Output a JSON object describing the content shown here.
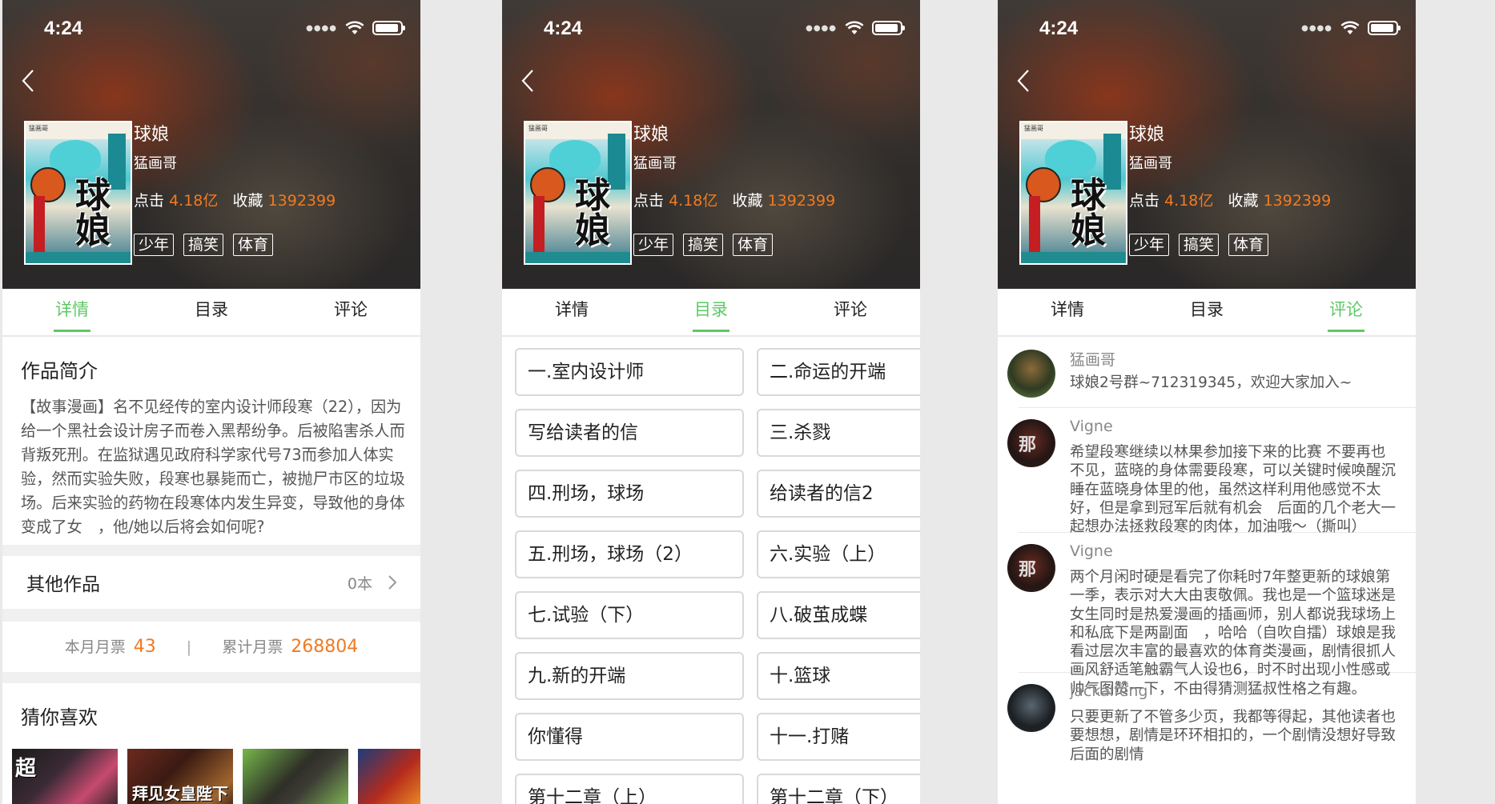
{
  "status": {
    "time": "4:24"
  },
  "comic": {
    "title": "球娘",
    "author": "猛画哥",
    "clicks_label": "点击",
    "clicks": "4.18亿",
    "favorites_label": "收藏",
    "favorites": "1392399",
    "tags": [
      "少年",
      "搞笑",
      "体育"
    ],
    "cover_head": "猛画哥",
    "cover_title": "球娘"
  },
  "tabs": [
    "详情",
    "目录",
    "评论"
  ],
  "detail": {
    "intro_heading": "作品简介",
    "intro_text": "【故事漫画】名不见经传的室内设计师段寒（22），因为给一个黑社会设计房子而卷入黑帮纷争。后被陷害杀人而背叛死刑。在监狱遇见政府科学家代号73而参加人体实验，然而实验失败，段寒也暴毙而亡，被抛尸市区的垃圾场。后来实验的药物在段寒体内发生异变，导致他的身体变成了女　，他/她以后将会如何呢?",
    "other_works_label": "其他作品",
    "other_works_count": "0本",
    "month_ticket_label": "本月月票",
    "month_ticket": "43",
    "separator": "|",
    "total_ticket_label": "累计月票",
    "total_ticket": "268804",
    "guess_heading": "猜你喜欢",
    "rec_texts": [
      "超",
      "拜见女皇陛下"
    ]
  },
  "catalog": [
    "一.室内设计师",
    "二.命运的开端",
    "写给读者的信",
    "三.杀戮",
    "四.刑场，球场",
    "给读者的信2",
    "五.刑场，球场（2）",
    "六.实验（上）",
    "七.试验（下）",
    "八.破茧成蝶",
    "九.新的开端",
    "十.篮球",
    "你懂得",
    "十一.打赌",
    "第十二章（上）",
    "第十二章（下）"
  ],
  "comments": [
    {
      "user": "猛画哥",
      "text": "球娘2号群~712319345，欢迎大家加入~"
    },
    {
      "user": "Vigne",
      "text": "希望段寒继续以林果参加接下来的比赛 不要再也不见，蓝晓的身体需要段寒，可以关键时候唤醒沉睡在蓝晓身体里的他，虽然这样利用他感觉不太好，但是拿到冠军后就有机会　后面的几个老大一起想办法拯救段寒的肉体，加油哦～（撕叫）"
    },
    {
      "user": "Vigne",
      "text": "两个月闲时硬是看完了你耗时7年整更新的球娘第一季，表示对大大由衷敬佩。我也是一个篮球迷是女生同时是热爱漫画的插画师，别人都说我球场上和私底下是两副面　，哈哈（自吹自擂）球娘是我看过层次丰富的最喜欢的体育类漫画，剧情很抓人画风舒适笔触霸气人设也6，时不时出现小性感或帅气图赞一下，不由得猜测猛叔性格之有趣。"
    },
    {
      "user": "jackalfeng",
      "text": "只要更新了不管多少页，我都等得起，其他读者也要想想，剧情是环环相扣的，一个剧情没想好导致后面的剧情"
    }
  ],
  "colors": {
    "accent_green": "#5ec864",
    "accent_orange": "#f07a22"
  }
}
